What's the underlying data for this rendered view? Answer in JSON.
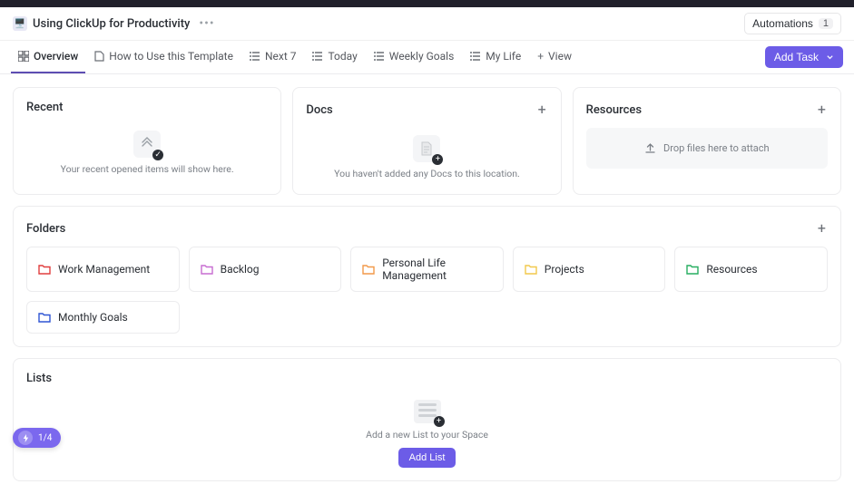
{
  "header": {
    "title": "Using ClickUp for Productivity",
    "automations_label": "Automations",
    "automations_count": "1"
  },
  "tabs": [
    {
      "label": "Overview"
    },
    {
      "label": "How to Use this Template"
    },
    {
      "label": "Next 7"
    },
    {
      "label": "Today"
    },
    {
      "label": "Weekly Goals"
    },
    {
      "label": "My Life"
    },
    {
      "label": "View"
    }
  ],
  "add_task_label": "Add Task",
  "cards": {
    "recent": {
      "title": "Recent",
      "empty_text": "Your recent opened items will show here."
    },
    "docs": {
      "title": "Docs",
      "empty_text": "You haven't added any Docs to this location."
    },
    "resources": {
      "title": "Resources",
      "dropzone_text": "Drop files here to attach"
    }
  },
  "folders": {
    "title": "Folders",
    "items": [
      {
        "name": "Work Management",
        "color": "#e03e3e"
      },
      {
        "name": "Backlog",
        "color": "#c76dd1"
      },
      {
        "name": "Personal Life Management",
        "color": "#f2994a"
      },
      {
        "name": "Projects",
        "color": "#f2c94c"
      },
      {
        "name": "Resources",
        "color": "#27ae60"
      },
      {
        "name": "Monthly Goals",
        "color": "#2f55d4"
      }
    ]
  },
  "lists": {
    "title": "Lists",
    "empty_text": "Add a new List to your Space",
    "button_label": "Add List"
  },
  "progress": {
    "label": "1/4"
  }
}
